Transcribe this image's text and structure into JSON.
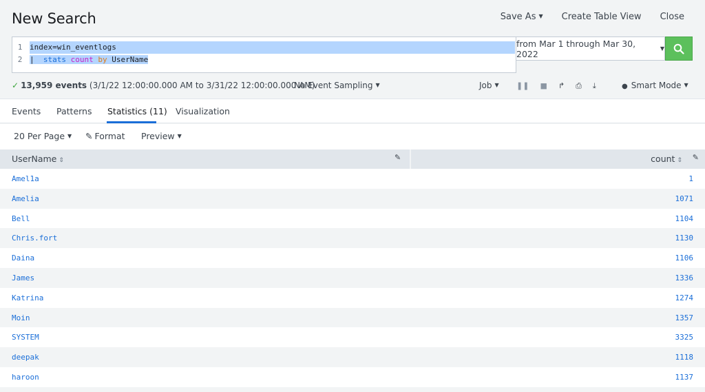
{
  "header": {
    "title": "New Search",
    "save_as": "Save As",
    "create_table_view": "Create Table View",
    "close": "Close"
  },
  "search": {
    "line_numbers": [
      "1",
      "2"
    ],
    "line1": "index=win_eventlogs",
    "line2_pipe": "|  ",
    "line2_cmd": "stats",
    "line2_fn": "count",
    "line2_by": "by",
    "line2_field": "UserName",
    "time_range": "from Mar 1 through Mar 30, 2022",
    "search_icon": "search-icon"
  },
  "status": {
    "event_count": "13,959 events",
    "range": "(3/1/22 12:00:00.000 AM to 3/31/22 12:00:00.000 AM)",
    "sampling": "No Event Sampling",
    "job": "Job",
    "mode": "Smart Mode"
  },
  "tabs": [
    {
      "label": "Events"
    },
    {
      "label": "Patterns"
    },
    {
      "label": "Statistics (11)"
    },
    {
      "label": "Visualization"
    }
  ],
  "options": {
    "per_page": "20 Per Page",
    "format": "Format",
    "preview": "Preview"
  },
  "table": {
    "col_user": "UserName",
    "col_count": "count",
    "rows": [
      {
        "user": "Amel1a",
        "count": "1"
      },
      {
        "user": "Amelia",
        "count": "1071"
      },
      {
        "user": "Bell",
        "count": "1104"
      },
      {
        "user": "Chris.fort",
        "count": "1130"
      },
      {
        "user": "Daina",
        "count": "1106"
      },
      {
        "user": "James",
        "count": "1336"
      },
      {
        "user": "Katrina",
        "count": "1274"
      },
      {
        "user": "Moin",
        "count": "1357"
      },
      {
        "user": "SYSTEM",
        "count": "3325"
      },
      {
        "user": "deepak",
        "count": "1118"
      },
      {
        "user": "haroon",
        "count": "1137"
      }
    ]
  }
}
